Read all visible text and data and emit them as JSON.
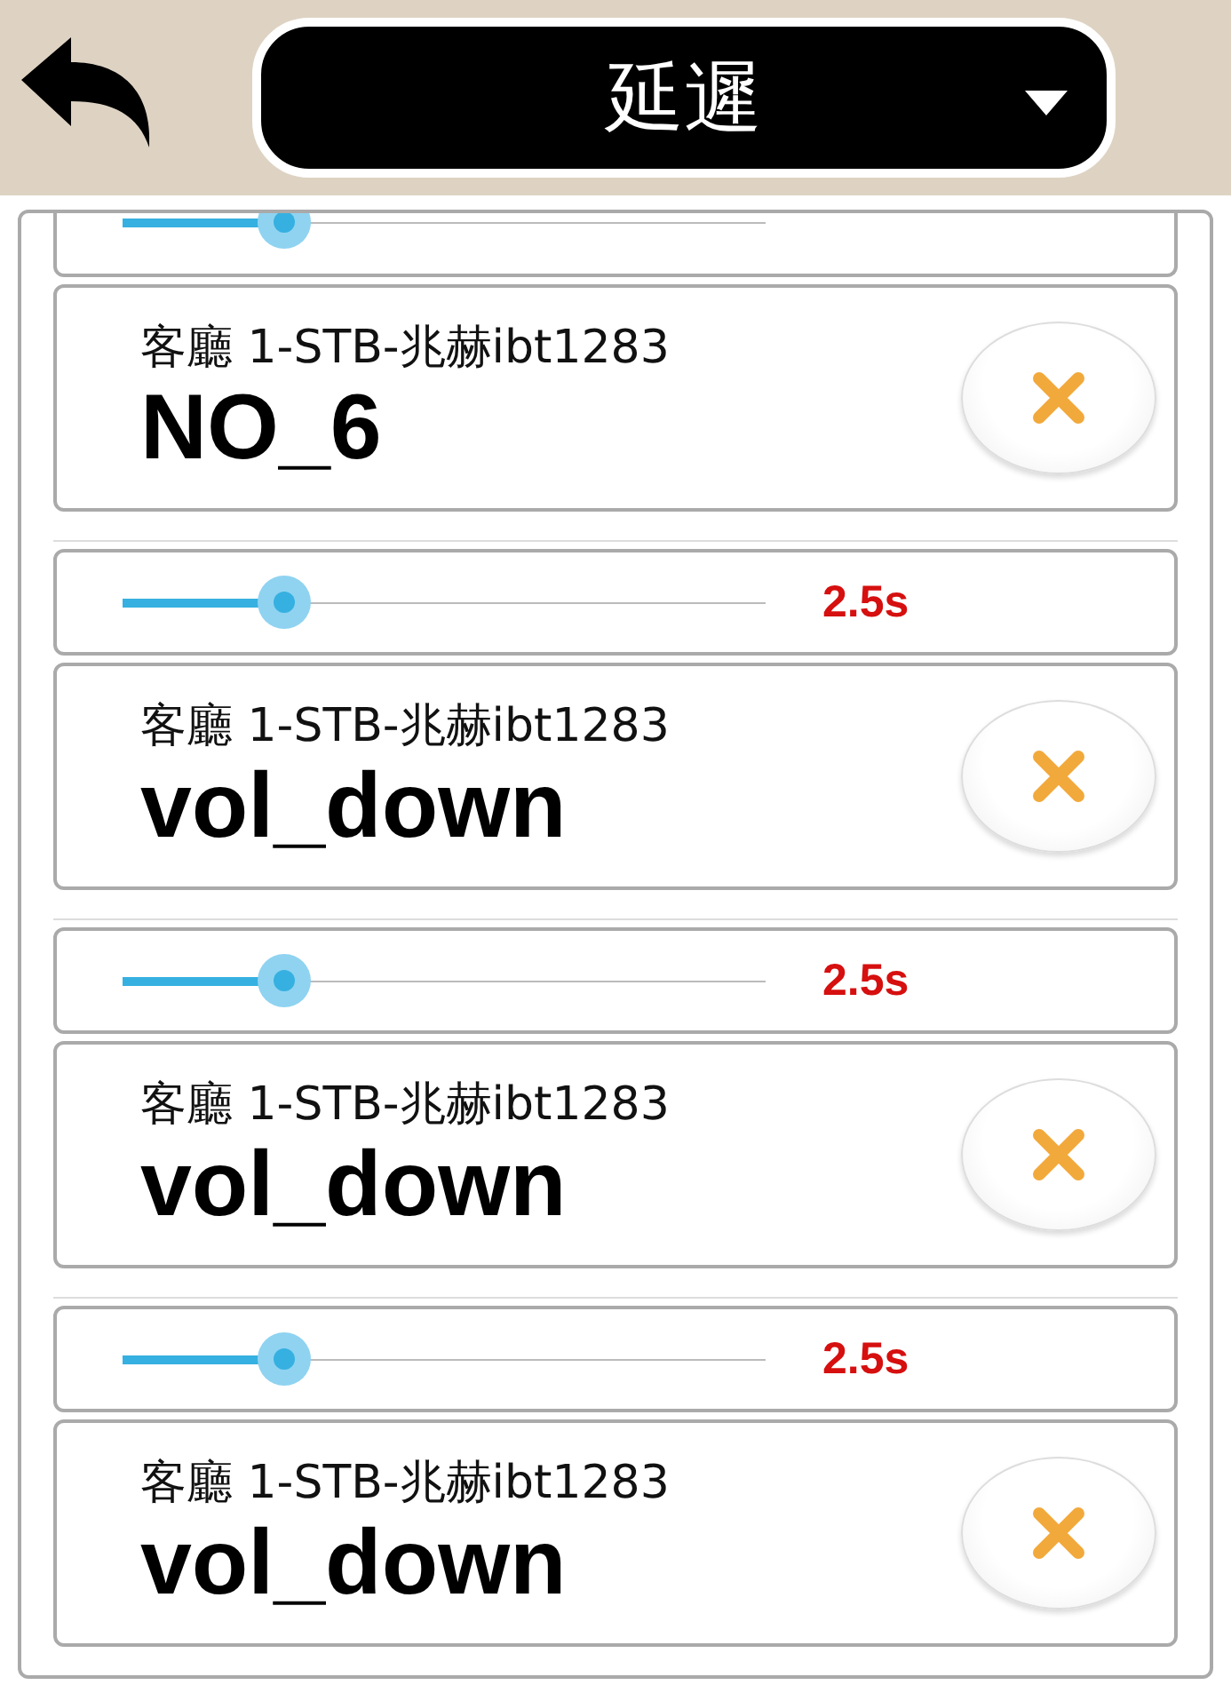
{
  "header": {
    "title": "延遲"
  },
  "items": [
    {
      "kind": "delay",
      "partial": true,
      "level": 0.25
    },
    {
      "kind": "command",
      "device": "客廳 1-STB-兆赫ibt1283",
      "name": "NO_6"
    },
    {
      "kind": "delay",
      "partial": false,
      "level": 0.25,
      "reading": "2.5s"
    },
    {
      "kind": "command",
      "device": "客廳 1-STB-兆赫ibt1283",
      "name": "vol_down"
    },
    {
      "kind": "delay",
      "partial": false,
      "level": 0.25,
      "reading": "2.5s"
    },
    {
      "kind": "command",
      "device": "客廳 1-STB-兆赫ibt1283",
      "name": "vol_down"
    },
    {
      "kind": "delay",
      "partial": false,
      "level": 0.25,
      "reading": "2.5s"
    },
    {
      "kind": "command",
      "device": "客廳 1-STB-兆赫ibt1283",
      "name": "vol_down"
    }
  ]
}
